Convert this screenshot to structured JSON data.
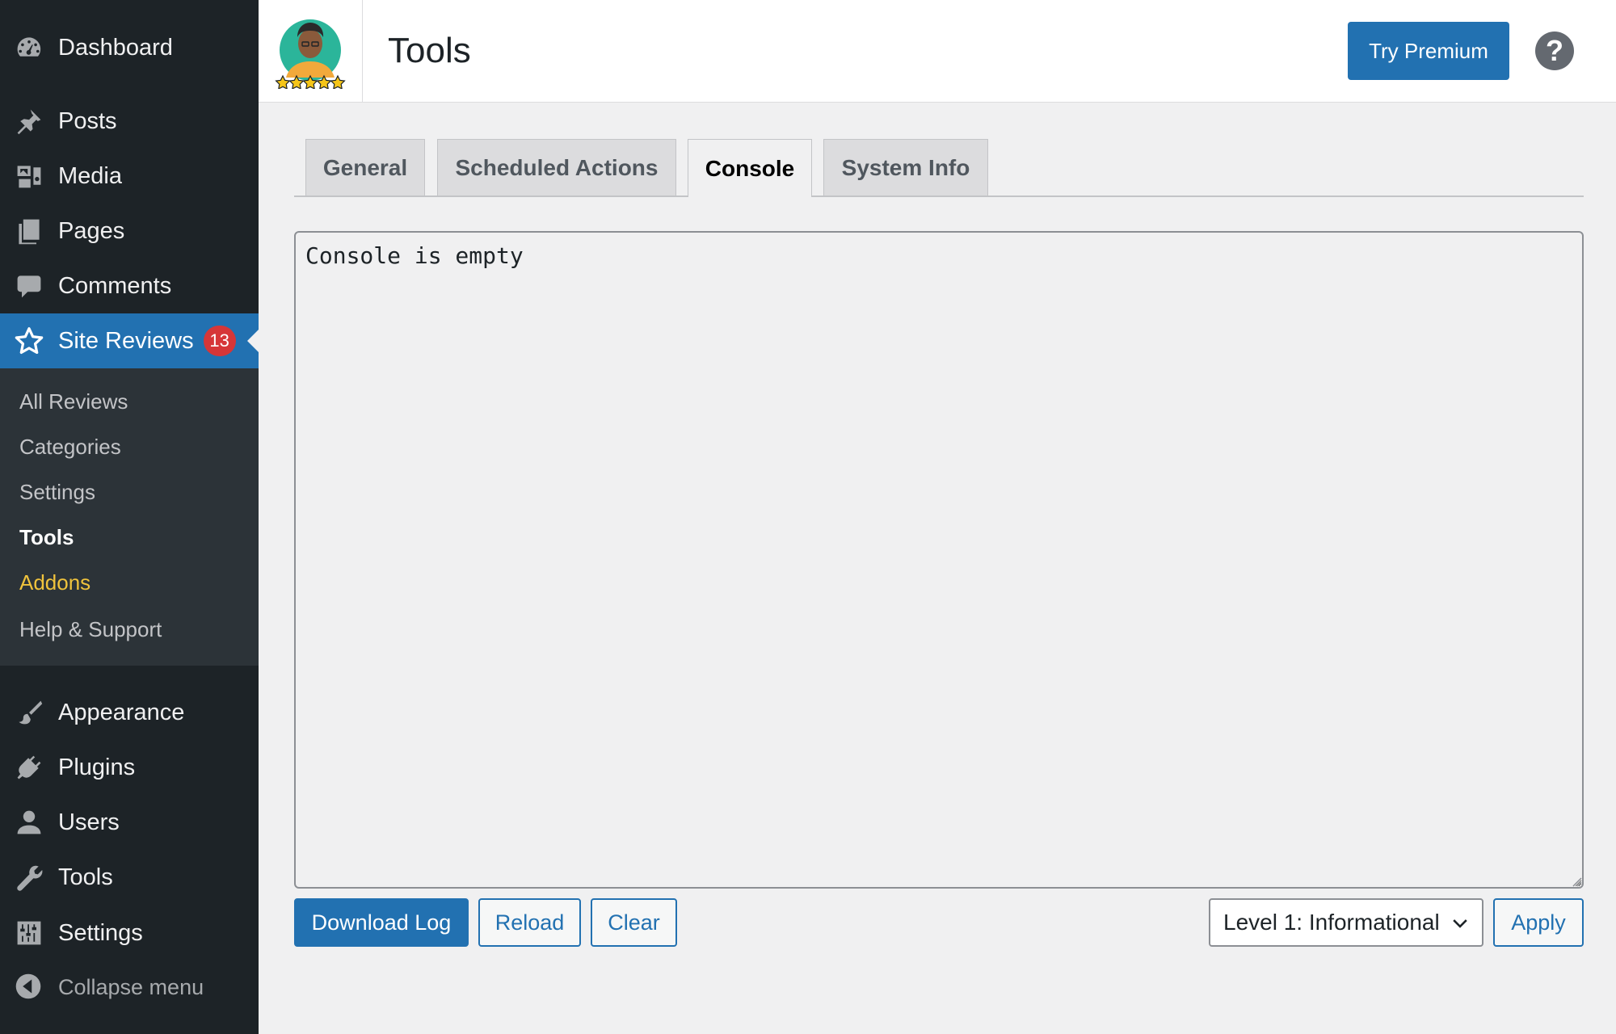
{
  "sidebar": {
    "items": [
      {
        "label": "Dashboard",
        "icon": "dashboard-icon"
      },
      {
        "label": "Posts",
        "icon": "pin-icon"
      },
      {
        "label": "Media",
        "icon": "media-icon"
      },
      {
        "label": "Pages",
        "icon": "pages-icon"
      },
      {
        "label": "Comments",
        "icon": "comment-icon"
      },
      {
        "label": "Site Reviews",
        "icon": "star-icon",
        "badge": "13",
        "active": true
      },
      {
        "label": "Appearance",
        "icon": "brush-icon"
      },
      {
        "label": "Plugins",
        "icon": "plugin-icon"
      },
      {
        "label": "Users",
        "icon": "user-icon"
      },
      {
        "label": "Tools",
        "icon": "wrench-icon"
      },
      {
        "label": "Settings",
        "icon": "sliders-icon"
      }
    ],
    "submenu": [
      {
        "label": "All Reviews"
      },
      {
        "label": "Categories"
      },
      {
        "label": "Settings"
      },
      {
        "label": "Tools",
        "current": true
      },
      {
        "label": "Addons",
        "highlight": true
      },
      {
        "label": "Help & Support"
      }
    ],
    "collapse_label": "Collapse menu"
  },
  "header": {
    "title": "Tools",
    "premium_button": "Try Premium",
    "help_glyph": "?"
  },
  "tabs": [
    {
      "label": "General"
    },
    {
      "label": "Scheduled Actions"
    },
    {
      "label": "Console",
      "active": true
    },
    {
      "label": "System Info"
    }
  ],
  "console": {
    "content": "Console is empty"
  },
  "actions": {
    "download_label": "Download Log",
    "reload_label": "Reload",
    "clear_label": "Clear",
    "level_selected": "Level 1: Informational",
    "apply_label": "Apply"
  },
  "colors": {
    "sidebar_bg": "#1d2327",
    "submenu_bg": "#2c3338",
    "accent": "#2271b1",
    "badge": "#d63638",
    "addons_highlight": "#f0c33c"
  }
}
